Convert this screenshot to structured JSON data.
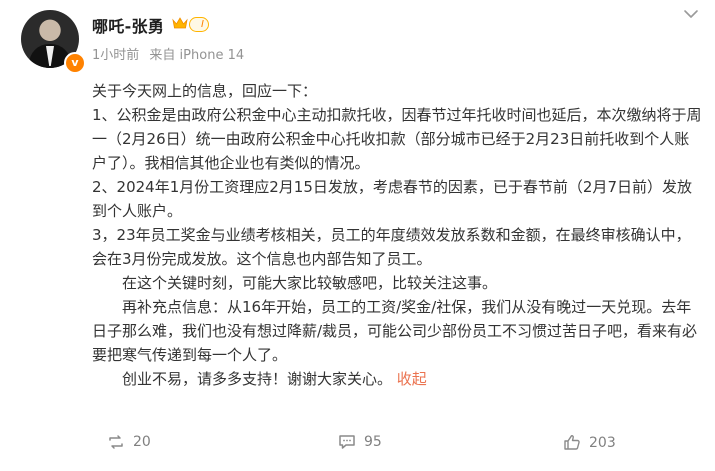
{
  "post": {
    "author_name": "哪吒-张勇",
    "level": "I",
    "time": "1小时前",
    "source": "来自 iPhone 14",
    "paragraphs": [
      "关于今天网上的信息，回应一下：",
      "1、公积金是由政府公积金中心主动扣款托收，因春节过年托收时间也延后，本次缴纳将于周一（2月26日）统一由政府公积金中心托收扣款（部分城市已经于2月23日前托收到个人账户了）。我相信其他企业也有类似的情况。",
      "2、2024年1月份工资理应2月15日发放，考虑春节的因素，已于春节前（2月7日前）发放到个人账户。",
      "3，23年员工奖金与业绩考核相关，员工的年度绩效发放系数和金额，在最终审核确认中，会在3月份完成发放。这个信息也内部告知了员工。",
      "在这个关键时刻，可能大家比较敏感吧，比较关注这事。",
      "再补充点信息：从16年开始，员工的工资/奖金/社保，我们从没有晚过一天兑现。去年日子那么难，我们也没有想过降薪/裁员，可能公司少部份员工不习惯过苦日子吧，看来有必要把寒气传递到每一个人了。",
      "创业不易，请多多支持！谢谢大家关心。"
    ],
    "collapse_label": "收起"
  },
  "actions": {
    "repost_count": "20",
    "comment_count": "95",
    "like_count": "203"
  },
  "colors": {
    "accent": "#eb7350",
    "vip": "#ff8200"
  }
}
